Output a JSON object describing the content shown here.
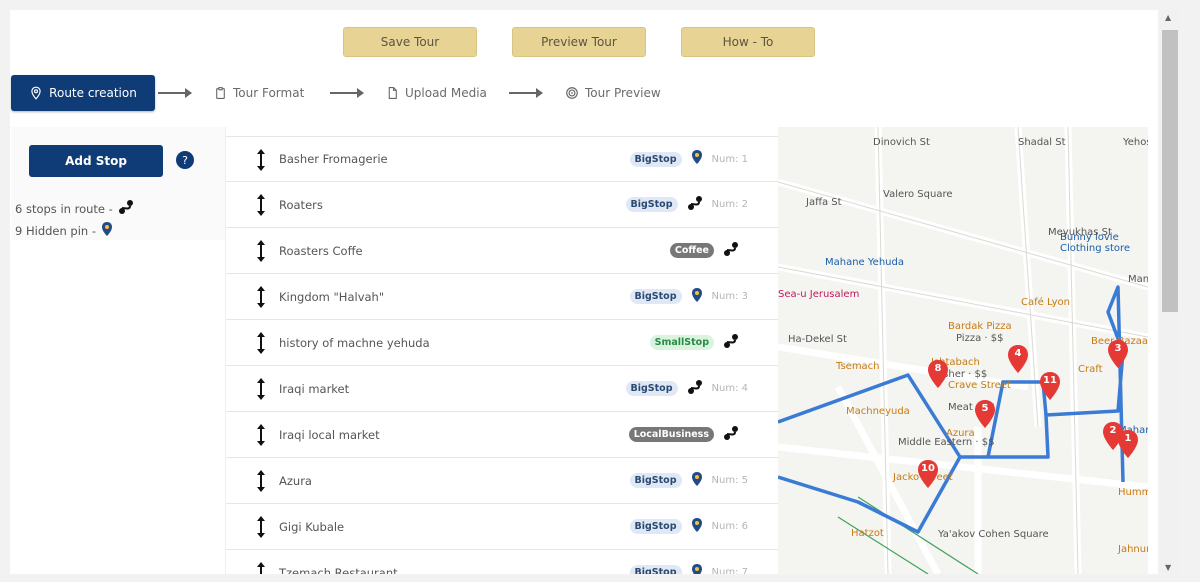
{
  "toolbar": {
    "save_label": "Save Tour",
    "preview_label": "Preview Tour",
    "howto_label": "How - To"
  },
  "steps": [
    {
      "label": "Route creation",
      "icon": "location-pin-icon",
      "active": true
    },
    {
      "label": "Tour Format",
      "icon": "clipboard-icon",
      "active": false
    },
    {
      "label": "Upload Media",
      "icon": "document-icon",
      "active": false
    },
    {
      "label": "Tour Preview",
      "icon": "target-icon",
      "active": false
    }
  ],
  "left_panel": {
    "add_stop_label": "Add Stop",
    "help_icon": "?",
    "stops_in_route": "6 stops in route -",
    "hidden_pins": "9 Hidden pin -"
  },
  "stops": [
    {
      "name": "Basher Fromagerie",
      "badge": "BigStop",
      "icon": "hidden-pin-icon",
      "num": "Num: 1"
    },
    {
      "name": "Roaters",
      "badge": "BigStop",
      "icon": "route-icon",
      "num": "Num: 2"
    },
    {
      "name": "Roasters Coffe",
      "badge": "Coffee",
      "icon": "route-icon",
      "num": ""
    },
    {
      "name": "Kingdom \"Halvah\"",
      "badge": "BigStop",
      "icon": "hidden-pin-icon",
      "num": "Num: 3"
    },
    {
      "name": "history of machne yehuda",
      "badge": "SmallStop",
      "icon": "route-icon",
      "num": ""
    },
    {
      "name": "Iraqi market",
      "badge": "BigStop",
      "icon": "route-icon",
      "num": "Num: 4"
    },
    {
      "name": "Iraqi local market",
      "badge": "LocalBusiness",
      "icon": "route-icon",
      "num": ""
    },
    {
      "name": "Azura",
      "badge": "BigStop",
      "icon": "hidden-pin-icon",
      "num": "Num: 5"
    },
    {
      "name": "Gigi Kubale",
      "badge": "BigStop",
      "icon": "hidden-pin-icon",
      "num": "Num: 6"
    },
    {
      "name": "Tzemach Restaurant",
      "badge": "BigStop",
      "icon": "hidden-pin-icon",
      "num": "Num: 7"
    }
  ],
  "map": {
    "labels": [
      "Jaffa St",
      "Valero Square",
      "Mahane Yehuda",
      "Sea-u Jerusalem",
      "Bunny lovie",
      "Clothing store",
      "Café Lyon",
      "Bardak Pizza",
      "Pizza · $$",
      "Ha-Dekel St",
      "Tsemach",
      "Ishtabach",
      "Kosher · $$",
      "Beer Bazaar",
      "Craft",
      "Mani",
      "Machneyuda",
      "Middle Eastern · $$",
      "Azura",
      "Jacko Street",
      "Hatzot",
      "Ya'akov Cohen Square",
      "Hummus",
      "Jahnun Bar",
      "Yehosef Shw",
      "Dinovich St",
      "Shadal St",
      "Meyukhas St",
      "Mahaneh Yehudah",
      "Crave Street",
      "Meat · $$"
    ],
    "markers": [
      "1",
      "2",
      "3",
      "4",
      "5",
      "8",
      "10",
      "11"
    ],
    "route_color": "#3a7bd5",
    "marker_color": "#e53935"
  }
}
